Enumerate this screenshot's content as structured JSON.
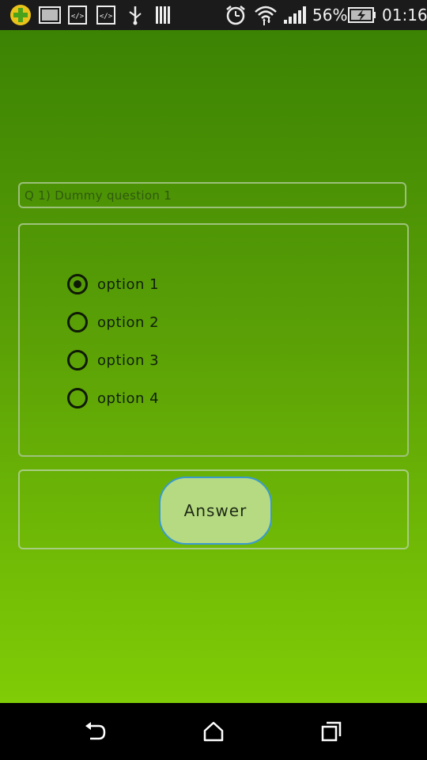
{
  "status_bar": {
    "icons": [
      "plus-badge-icon",
      "image-notification-icon",
      "code-notification-icon",
      "code-notification-icon",
      "usb-icon",
      "barcode-icon",
      "alarm-icon",
      "wifi-icon",
      "signal-icon",
      "battery-charging-icon"
    ],
    "battery_percent": "56%",
    "time": "01:16"
  },
  "question": {
    "text": "Q 1) Dummy question 1"
  },
  "options": [
    {
      "label": "option 1",
      "selected": true
    },
    {
      "label": "option 2",
      "selected": false
    },
    {
      "label": "option 3",
      "selected": false
    },
    {
      "label": "option 4",
      "selected": false
    }
  ],
  "answer_button": {
    "label": "Answer"
  },
  "nav_bar": {
    "icons": [
      "back-icon",
      "home-icon",
      "recents-icon"
    ]
  },
  "colors": {
    "gradient_top": "#3c8304",
    "gradient_bottom": "#80cc06",
    "button_fill": "#b6da82",
    "button_border": "#3a9ad0"
  }
}
